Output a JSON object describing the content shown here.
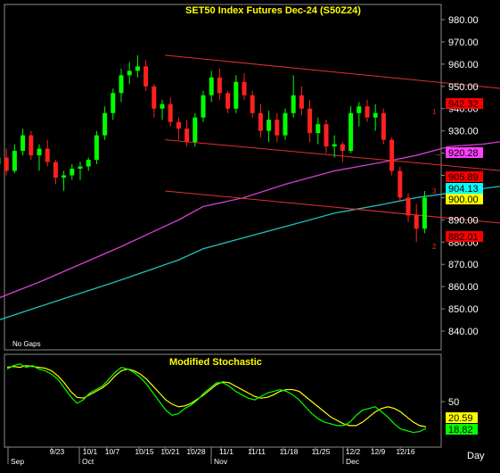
{
  "chart_data": [
    {
      "type": "candlestick",
      "title": "SET50  Index  Futures  Dec-24  (S50Z24)",
      "annotation_bottom_left": "No Gaps",
      "ylim": [
        833,
        987
      ],
      "y_ticks": [
        "980.00",
        "970.00",
        "960.00",
        "950.00",
        "940.00",
        "930.00",
        "920.00",
        "910.00",
        "900.00",
        "890.00",
        "880.00",
        "870.00",
        "860.00",
        "850.00",
        "840.00"
      ],
      "x_ticks": [
        "9/23",
        "10/1",
        "10/7",
        "10/15",
        "10/21",
        "10/28",
        "11/1",
        "11/11",
        "11/18",
        "11/25",
        "12/2",
        "12/9",
        "12/16"
      ],
      "month_labels": [
        "Sep",
        "Oct",
        "Nov",
        "Dec"
      ],
      "price_labels": [
        {
          "text": "942.32",
          "value": 942.32,
          "bg": "#ff0000",
          "fg": "#000000"
        },
        {
          "text": "920.28",
          "value": 920.28,
          "bg": "#ff40ff",
          "fg": "#000000"
        },
        {
          "text": "905.89",
          "value": 905.89,
          "bg": "#ff0000",
          "fg": "#000000"
        },
        {
          "text": "904.13",
          "value": 904.13,
          "bg": "#00ffff",
          "fg": "#000000"
        },
        {
          "text": "900.00",
          "value": 900.0,
          "bg": "#ffff00",
          "fg": "#000000"
        },
        {
          "text": "882.01",
          "value": 882.01,
          "bg": "#ff0000",
          "fg": "#000000"
        }
      ],
      "channel_line_labels": [
        "1",
        "3",
        "2"
      ],
      "channel_lines": [
        {
          "name": "1",
          "from": [
            1.0,
            964.0
          ],
          "to": [
            55.0,
            942.32
          ]
        },
        {
          "name": "3",
          "from": [
            1.0,
            926.0
          ],
          "to": [
            55.0,
            905.89
          ]
        },
        {
          "name": "2",
          "from": [
            1.0,
            903.0
          ],
          "to": [
            55.0,
            882.01
          ]
        }
      ],
      "moving_average_magenta": [
        [
          -29,
          849
        ],
        [
          -20,
          862
        ],
        [
          -10,
          878
        ],
        [
          -3,
          890
        ],
        [
          0,
          896
        ],
        [
          5,
          900
        ],
        [
          10,
          906
        ],
        [
          16,
          912
        ],
        [
          22,
          916
        ],
        [
          26,
          919
        ],
        [
          30,
          923
        ],
        [
          34,
          924
        ],
        [
          38,
          926
        ],
        [
          42,
          927
        ],
        [
          45,
          927
        ],
        [
          49,
          925
        ],
        [
          52,
          920.28
        ]
      ],
      "moving_average_cyan": [
        [
          -29,
          840
        ],
        [
          -20,
          851
        ],
        [
          -10,
          863
        ],
        [
          -3,
          872
        ],
        [
          0,
          877
        ],
        [
          5,
          882
        ],
        [
          10,
          887
        ],
        [
          16,
          893
        ],
        [
          22,
          897
        ],
        [
          26,
          900
        ],
        [
          30,
          902
        ],
        [
          34,
          904
        ],
        [
          38,
          906
        ],
        [
          42,
          907
        ],
        [
          45,
          907
        ],
        [
          49,
          905
        ],
        [
          52,
          904.13
        ]
      ],
      "candles": [
        [
          -31,
          899,
          904,
          897,
          902
        ],
        [
          -30,
          902,
          905,
          900,
          903
        ],
        [
          -29,
          903,
          912,
          901,
          910
        ],
        [
          -28,
          910,
          913,
          906,
          908
        ],
        [
          -27,
          908,
          910,
          903,
          905
        ],
        [
          -26,
          905,
          917,
          904,
          915
        ],
        [
          -25,
          915,
          921,
          913,
          918
        ],
        [
          -24,
          918,
          922,
          910,
          912
        ],
        [
          -23,
          912,
          924,
          911,
          921
        ],
        [
          -22,
          921,
          931,
          919,
          928
        ],
        [
          -21,
          928,
          930,
          917,
          919
        ],
        [
          -20,
          919,
          924,
          912,
          922
        ],
        [
          -19,
          922,
          926,
          914,
          916
        ],
        [
          -18,
          916,
          917,
          906,
          909
        ],
        [
          -17,
          909,
          912,
          903,
          910
        ],
        [
          -16,
          910,
          915,
          908,
          913
        ],
        [
          -15,
          913,
          916,
          908,
          914
        ],
        [
          -14,
          914,
          918,
          912,
          917
        ],
        [
          -13,
          917,
          930,
          915,
          928
        ],
        [
          -12,
          928,
          941,
          926,
          938
        ],
        [
          -11,
          938,
          949,
          935,
          947
        ],
        [
          -10,
          947,
          958,
          943,
          955
        ],
        [
          -9,
          955,
          961,
          951,
          957
        ],
        [
          -8,
          957,
          964,
          954,
          959
        ],
        [
          -7,
          959,
          962,
          948,
          950
        ],
        [
          -6,
          950,
          951,
          936,
          940
        ],
        [
          -5,
          940,
          944,
          935,
          942
        ],
        [
          -4,
          942,
          945,
          932,
          934
        ],
        [
          -3,
          934,
          936,
          926,
          931
        ],
        [
          -2,
          931,
          935,
          923,
          925
        ],
        [
          -1,
          925,
          938,
          923,
          936
        ],
        [
          0,
          936,
          948,
          934,
          946
        ],
        [
          1,
          946,
          957,
          943,
          954
        ],
        [
          2,
          954,
          958,
          944,
          947
        ],
        [
          3,
          947,
          948,
          938,
          940
        ],
        [
          4,
          940,
          955,
          938,
          952
        ],
        [
          5,
          952,
          956,
          944,
          946
        ],
        [
          6,
          946,
          948,
          936,
          938
        ],
        [
          7,
          938,
          942,
          927,
          930
        ],
        [
          8,
          930,
          939,
          925,
          935
        ],
        [
          9,
          935,
          938,
          925,
          928
        ],
        [
          10,
          928,
          940,
          926,
          938
        ],
        [
          11,
          938,
          955,
          936,
          946
        ],
        [
          12,
          946,
          950,
          937,
          940
        ],
        [
          13,
          940,
          944,
          925,
          929
        ],
        [
          14,
          929,
          936,
          924,
          933
        ],
        [
          15,
          933,
          935,
          920,
          923
        ],
        [
          16,
          923,
          928,
          918,
          924
        ],
        [
          17,
          924,
          925,
          916,
          921
        ],
        [
          18,
          921,
          941,
          920,
          938
        ],
        [
          19,
          938,
          943,
          932,
          941
        ],
        [
          20,
          941,
          944,
          934,
          936
        ],
        [
          21,
          936,
          942,
          930,
          938
        ],
        [
          22,
          938,
          940,
          924,
          926
        ],
        [
          23,
          926,
          927,
          910,
          912
        ],
        [
          24,
          912,
          914,
          898,
          900
        ],
        [
          25,
          900,
          902,
          889,
          892
        ],
        [
          26,
          892,
          897,
          880,
          886
        ],
        [
          27,
          886,
          903,
          884,
          900
        ]
      ]
    },
    {
      "type": "line",
      "title": "Modified  Stochastic",
      "ylim": [
        0,
        100
      ],
      "y_ticks": [
        "50"
      ],
      "value_labels": [
        {
          "text": "20.59",
          "bg": "#ffff00",
          "fg": "#000000"
        },
        {
          "text": "18.82",
          "bg": "#00ff00",
          "fg": "#000000"
        }
      ],
      "series": [
        {
          "color": "#ffff00",
          "values": [
            90,
            91,
            90,
            92,
            91,
            90,
            89,
            86,
            80,
            72,
            62,
            55,
            54,
            58,
            62,
            66,
            72,
            80,
            86,
            88,
            86,
            82,
            76,
            68,
            60,
            52,
            47,
            44,
            45,
            48,
            53,
            58,
            64,
            70,
            73,
            72,
            68,
            64,
            60,
            56,
            54,
            55,
            58,
            62,
            64,
            64,
            62,
            56,
            50,
            44,
            38,
            32,
            28,
            24,
            22,
            22,
            26,
            32,
            38,
            42,
            44,
            42,
            38,
            32,
            26,
            22,
            20.59
          ]
        },
        {
          "color": "#00ff00",
          "values": [
            88,
            92,
            94,
            90,
            92,
            88,
            86,
            82,
            76,
            66,
            56,
            48,
            52,
            60,
            64,
            68,
            76,
            84,
            90,
            88,
            84,
            78,
            70,
            60,
            50,
            40,
            34,
            36,
            42,
            46,
            52,
            60,
            66,
            72,
            72,
            68,
            62,
            58,
            54,
            52,
            56,
            60,
            62,
            64,
            62,
            58,
            52,
            44,
            36,
            30,
            26,
            24,
            22,
            22,
            26,
            34,
            40,
            42,
            44,
            38,
            32,
            24,
            18,
            16,
            14,
            15,
            18.82
          ]
        }
      ]
    }
  ],
  "label_day": "Day"
}
